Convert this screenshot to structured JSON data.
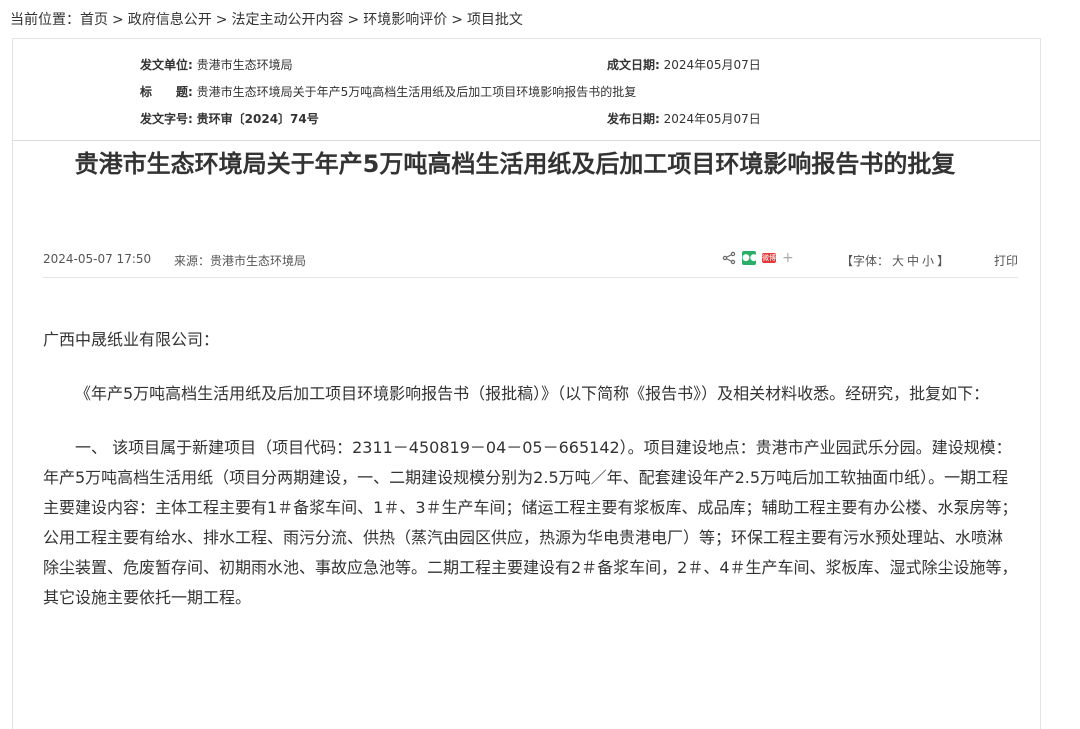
{
  "breadcrumb": {
    "prefix": "当前位置：",
    "items": [
      "首页",
      "政府信息公开",
      "法定主动公开内容",
      "环境影响评价",
      "项目批文"
    ],
    "separator": ">"
  },
  "meta": {
    "issuer_label": "发文单位:",
    "issuer": "贵港市生态环境局",
    "created_label": "成文日期:",
    "created": "2024年05月07日",
    "title_label": "标　　题:",
    "title": "贵港市生态环境局关于年产5万吨高档生活用纸及后加工项目环境影响报告书的批复",
    "docno_label": "发文字号:",
    "docno": "贵环审〔2024〕74号",
    "published_label": "发布日期:",
    "published": "2024年05月07日"
  },
  "article": {
    "title": "贵港市生态环境局关于年产5万吨高档生活用纸及后加工项目环境影响报告书的批复",
    "datetime": "2024-05-07 17:50",
    "source_label": "来源：",
    "source": "贵港市生态环境局",
    "fontsize_label": "【字体：",
    "fontsize_big": "大",
    "fontsize_mid": "中",
    "fontsize_small": "小",
    "fontsize_end": "】",
    "print": "打印",
    "share_icons": [
      "share-icon",
      "wechat-icon",
      "weibo-icon",
      "plus-icon"
    ],
    "paragraphs": [
      "广西中晟纸业有限公司：",
      "《年产5万吨高档生活用纸及后加工项目环境影响报告书（报批稿）》（以下简称《报告书》）及相关材料收悉。经研究，批复如下：",
      "一、 该项目属于新建项目（项目代码：2311－450819－04－05－665142）。项目建设地点：贵港市产业园武乐分园。建设规模：年产5万吨高档生活用纸（项目分两期建设，一、二期建设规模分别为2.5万吨／年、配套建设年产2.5万吨后加工软抽面巾纸）。一期工程主要建设内容：主体工程主要有1＃备浆车间、1＃、3＃生产车间；储运工程主要有浆板库、成品库；辅助工程主要有办公楼、水泵房等；公用工程主要有给水、排水工程、雨污分流、供热（蒸汽由园区供应，热源为华电贵港电厂）等；环保工程主要有污水预处理站、水喷淋除尘装置、危废暂存间、初期雨水池、事故应急池等。二期工程主要建设有2＃备浆车间，2＃、4＃生产车间、浆板库、湿式除尘设施等，其它设施主要依托一期工程。"
    ]
  }
}
